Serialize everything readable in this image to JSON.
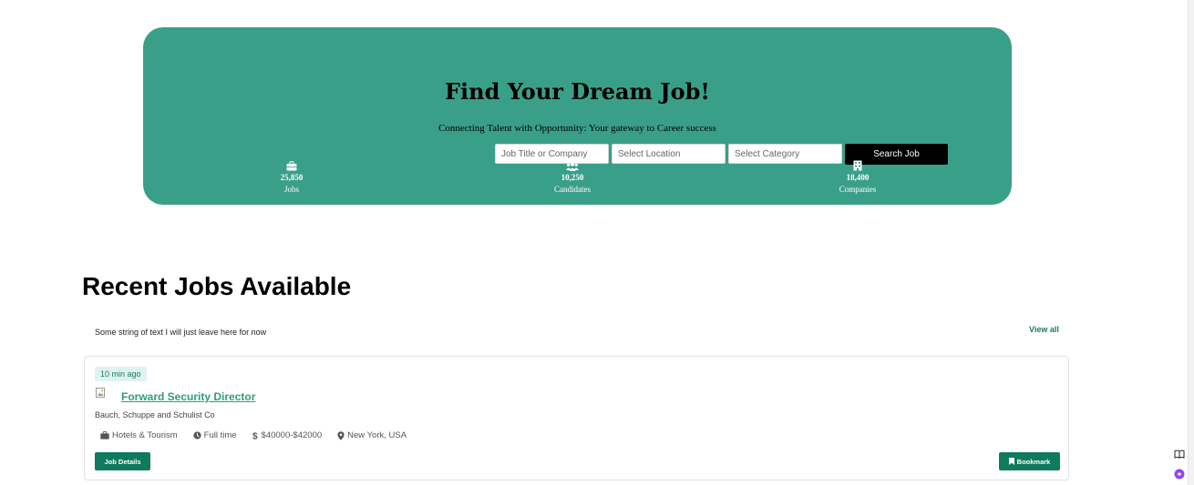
{
  "hero": {
    "title": "Find Your Dream Job!",
    "subtitle": "Connecting Talent with Opportunity: Your gateway to Career success",
    "search": {
      "title_placeholder": "Job Title or Company",
      "location_placeholder": "Select Location",
      "category_placeholder": "Select Category",
      "button_label": "Search Job"
    },
    "stats": [
      {
        "icon": "briefcase-icon",
        "value": "25,850",
        "label": "Jobs"
      },
      {
        "icon": "users-icon",
        "value": "10,250",
        "label": "Candidates"
      },
      {
        "icon": "building-icon",
        "value": "18,400",
        "label": "Companies"
      }
    ],
    "background_color": "#3a9f88"
  },
  "recent": {
    "title": "Recent Jobs Available",
    "description": "Some string of text I will just leave here for now",
    "view_all_label": "View all",
    "jobs": [
      {
        "posted": "10 min ago",
        "title": "Forward Security Director",
        "company": "Bauch, Schuppe and Schulist Co",
        "category": "Hotels & Tourism",
        "type": "Full time",
        "salary": "$40000-$42000",
        "location": "New York, USA",
        "details_label": "Job Details",
        "bookmark_label": "Bookmark"
      }
    ]
  },
  "colors": {
    "accent": "#0f7a5d",
    "title_green": "#2f9d7f",
    "badge_bg": "#dff3ee"
  }
}
